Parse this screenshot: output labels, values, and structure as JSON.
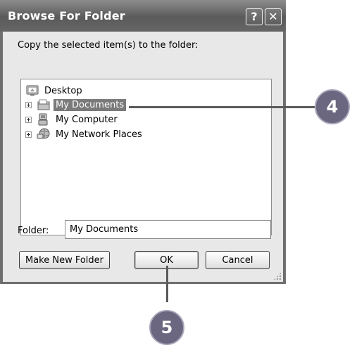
{
  "window": {
    "title": "Browse For Folder",
    "help_glyph": "?",
    "close_glyph": "✕"
  },
  "instruction": "Copy the selected item(s) to the folder:",
  "tree": {
    "root": {
      "label": "Desktop",
      "icon": "desktop-icon"
    },
    "items": [
      {
        "label": "My Documents",
        "icon": "my-documents-icon",
        "selected": true
      },
      {
        "label": "My Computer",
        "icon": "my-computer-icon",
        "selected": false
      },
      {
        "label": "My Network Places",
        "icon": "network-places-icon",
        "selected": false
      }
    ]
  },
  "folder": {
    "label": "Folder:",
    "value": "My Documents"
  },
  "buttons": {
    "make_new_folder": "Make New Folder",
    "ok": "OK",
    "cancel": "Cancel"
  },
  "callouts": {
    "step4": "4",
    "step5": "5"
  },
  "colors": {
    "selection": "#7a7a7a",
    "callout": "#6b6780",
    "titlebar": "#6e6e6e"
  }
}
